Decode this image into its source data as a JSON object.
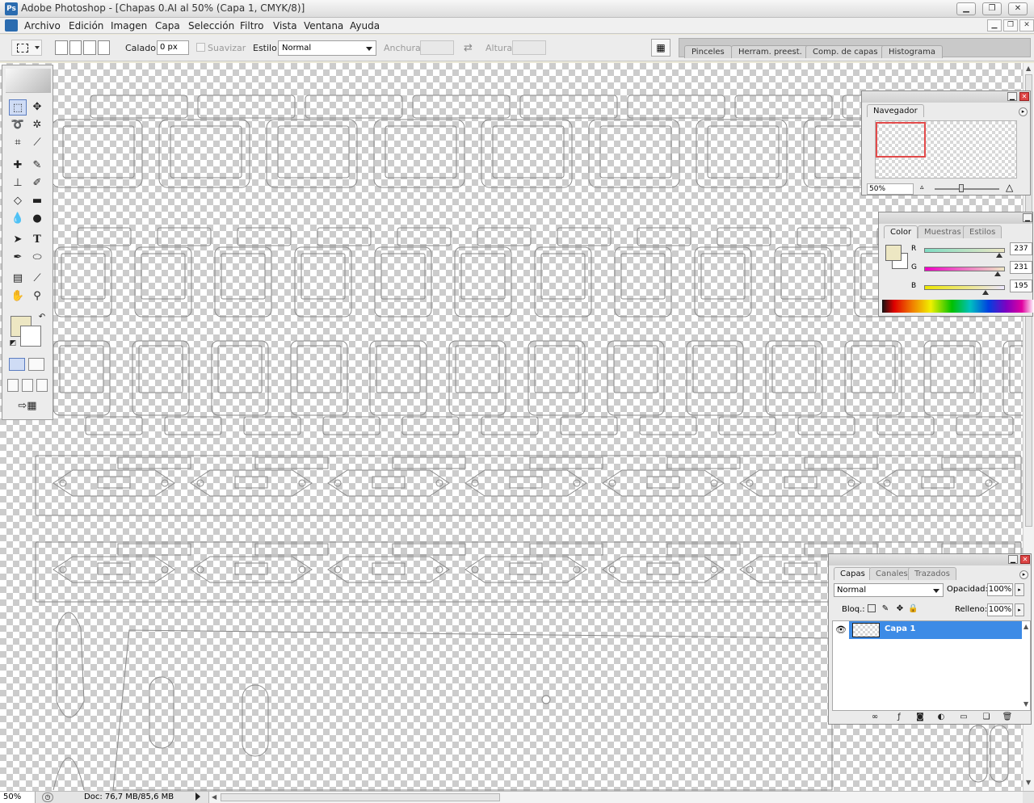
{
  "window": {
    "title": "Adobe Photoshop - [Chapas 0.AI al 50% (Capa 1, CMYK/8)]",
    "controls": [
      "minimize",
      "restore",
      "close"
    ]
  },
  "menubar": {
    "items": [
      "Archivo",
      "Edición",
      "Imagen",
      "Capa",
      "Selección",
      "Filtro",
      "Vista",
      "Ventana",
      "Ayuda"
    ]
  },
  "options": {
    "feather_label": "Calado:",
    "feather_value": "0 px",
    "antialias_label": "Suavizar",
    "style_label": "Estilo:",
    "style_value": "Normal",
    "width_label": "Anchura:",
    "height_label": "Altura:",
    "well_tabs": [
      "Pinceles",
      "Herram. preest.",
      "Comp. de capas",
      "Histograma"
    ]
  },
  "navigator": {
    "tab": "Navegador",
    "zoom": "50%"
  },
  "color": {
    "tabs": [
      "Color",
      "Muestras",
      "Estilos"
    ],
    "channels": [
      {
        "label": "R",
        "value": "237",
        "fraction": 0.93,
        "gradient": [
          "#7fdcc3",
          "#ede7c3"
        ]
      },
      {
        "label": "G",
        "value": "231",
        "fraction": 0.91,
        "gradient": [
          "#ed00c3",
          "#ede7c3"
        ]
      },
      {
        "label": "B",
        "value": "195",
        "fraction": 0.76,
        "gradient": [
          "#ede700",
          "#ede7ff"
        ]
      }
    ],
    "foreground": "#ede7c3",
    "background": "#ffffff"
  },
  "layers": {
    "tabs": [
      "Capas",
      "Canales",
      "Trazados"
    ],
    "blend_mode": "Normal",
    "opacity_label": "Opacidad:",
    "opacity": "100%",
    "lock_label": "Bloq.:",
    "fill_label": "Relleno:",
    "fill": "100%",
    "rows": [
      {
        "name": "Capa 1",
        "visible": true,
        "selected": true
      }
    ]
  },
  "status": {
    "zoom": "50%",
    "doc": "Doc: 76,7 MB/85,6 MB"
  },
  "toolbox": {
    "tools": [
      "rect-marquee",
      "move",
      "lasso",
      "magic-wand",
      "crop",
      "slice",
      "healing-brush",
      "brush",
      "clone-stamp",
      "history-brush",
      "eraser",
      "gradient",
      "blur",
      "dodge",
      "path-select",
      "type",
      "pen",
      "ellipse",
      "notes",
      "eyedropper",
      "hand",
      "zoom"
    ],
    "foreground": "#ede7c3",
    "background": "#ffffff"
  }
}
